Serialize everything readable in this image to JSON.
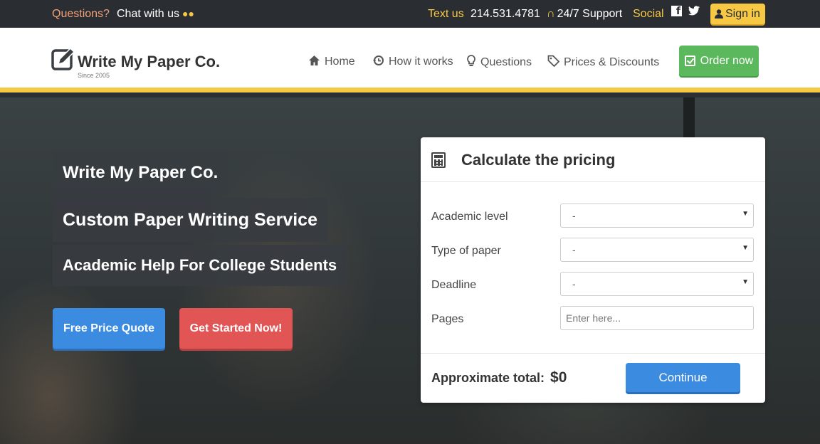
{
  "topbar": {
    "questions": "Questions?",
    "chat": "Chat with us",
    "text_us": "Text us",
    "phone": "214.531.4781",
    "support": "24/7 Support",
    "social": "Social",
    "signin": "Sign in"
  },
  "nav": {
    "logo": "Write My Paper Co.",
    "since": "Since 2005",
    "items": [
      {
        "label": "Home",
        "icon": "home-icon"
      },
      {
        "label": "How it works",
        "icon": "history-icon"
      },
      {
        "label": "Questions",
        "icon": "lightbulb-icon"
      },
      {
        "label": "Prices & Discounts",
        "icon": "tag-icon"
      }
    ],
    "order": "Order now"
  },
  "hero": {
    "title1": "Write My Paper Co.",
    "title2": "Custom Paper Writing Service",
    "title3": "Academic Help For College Students",
    "btn_quote": "Free Price Quote",
    "btn_start": "Get Started Now!"
  },
  "calculator": {
    "title": "Calculate the pricing",
    "fields": [
      {
        "label": "Academic level",
        "value": "-"
      },
      {
        "label": "Type of paper",
        "value": "-"
      },
      {
        "label": "Deadline",
        "value": "-"
      },
      {
        "label": "Pages",
        "placeholder": "Enter here..."
      }
    ],
    "total_label": "Approximate total:",
    "total_value": "$0",
    "continue": "Continue"
  },
  "colors": {
    "accent_yellow": "#f7c843",
    "order_green": "#5cb85c",
    "blue": "#3b8be0",
    "red": "#e25555",
    "topbar": "#2a2e33"
  }
}
